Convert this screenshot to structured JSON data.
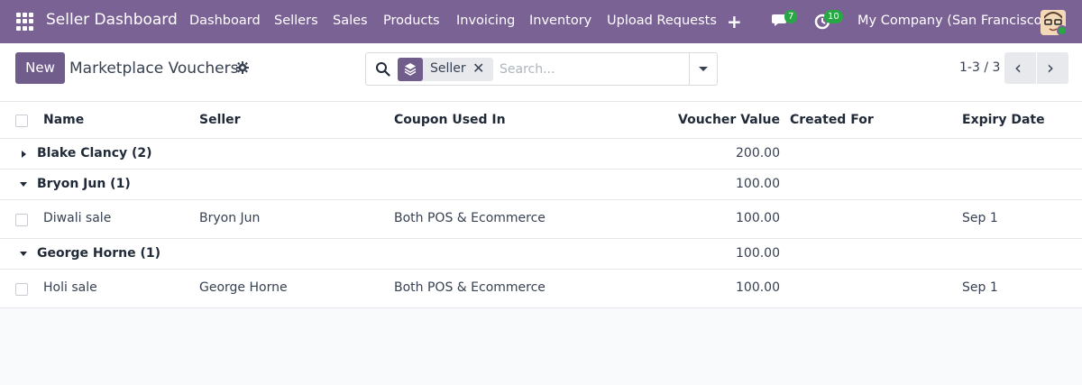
{
  "navbar": {
    "brand": "Seller Dashboard",
    "menu": [
      "Dashboard",
      "Sellers",
      "Sales",
      "Products",
      "Invoicing",
      "Inventory",
      "Upload Requests"
    ],
    "messages_count": "7",
    "activities_count": "10",
    "company": "My Company (San Francisco)"
  },
  "control": {
    "new_label": "New",
    "title": "Marketplace Vouchers",
    "facet_label": "Seller",
    "search_placeholder": "Search...",
    "pager": "1-3 / 3"
  },
  "table": {
    "headers": {
      "name": "Name",
      "seller": "Seller",
      "coupon": "Coupon Used In",
      "value": "Voucher Value",
      "created_for": "Created For",
      "expiry": "Expiry Date"
    },
    "groups": [
      {
        "label": "Blake Clancy (2)",
        "total": "200.00",
        "expanded": false
      },
      {
        "label": "Bryon Jun (1)",
        "total": "100.00",
        "expanded": true,
        "record": {
          "name": "Diwali sale",
          "seller": "Bryon Jun",
          "coupon": "Both POS & Ecommerce",
          "value": "100.00",
          "created_for": "",
          "expiry": "Sep 1"
        }
      },
      {
        "label": "George Horne (1)",
        "total": "100.00",
        "expanded": true,
        "record": {
          "name": "Holi sale",
          "seller": "George Horne",
          "coupon": "Both POS & Ecommerce",
          "value": "100.00",
          "created_for": "",
          "expiry": "Sep 1"
        }
      }
    ]
  },
  "colors": {
    "navbar": "#7a6295",
    "primary": "#715d8c",
    "badge": "#28a745"
  },
  "icons": [
    "apps-grid-icon",
    "plus-icon",
    "chat-icon",
    "activity-clock-icon",
    "gear-icon",
    "search-icon",
    "layers-icon",
    "close-icon",
    "caret-down-icon",
    "chevron-left-icon",
    "chevron-right-icon"
  ]
}
